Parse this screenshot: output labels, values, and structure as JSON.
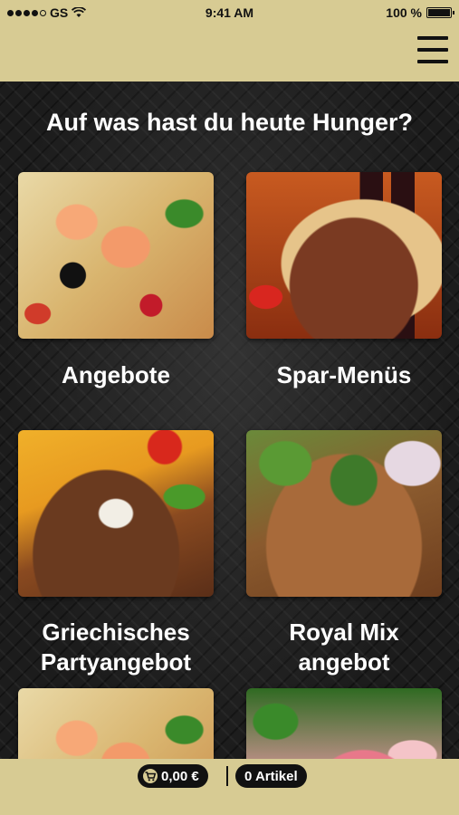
{
  "status_bar": {
    "carrier": "GS",
    "time": "9:41 AM",
    "battery": "100 %",
    "battery_level": 1.0,
    "signal_bars_filled": 4,
    "signal_bars_total": 5
  },
  "header": {
    "menu_icon": "hamburger-menu-icon"
  },
  "main": {
    "heading": "Auf was hast du heute Hunger?",
    "categories": [
      {
        "label_lines": [
          "Angebote"
        ],
        "image": "shrimp-pizza-photo"
      },
      {
        "label_lines": [
          "Spar-Menüs"
        ],
        "image": "doner-cola-photo"
      },
      {
        "label_lines": [
          "Griechisches",
          "Partyangebot"
        ],
        "image": "gyros-fries-photo"
      },
      {
        "label_lines": [
          "Royal Mix",
          "angebot"
        ],
        "image": "gyros-salad-photo"
      },
      {
        "label_lines": [],
        "image": "shrimp-pizza-photo"
      },
      {
        "label_lines": [],
        "image": "ham-salad-photo"
      }
    ]
  },
  "footer": {
    "cart_total": "0,00 €",
    "cart_icon": "cart-icon",
    "item_count": "0 Artikel"
  },
  "colors": {
    "bar_background": "#d7cb93",
    "main_background": "#1c1c1c",
    "text_light": "#ffffff",
    "pill_background": "#111111"
  }
}
